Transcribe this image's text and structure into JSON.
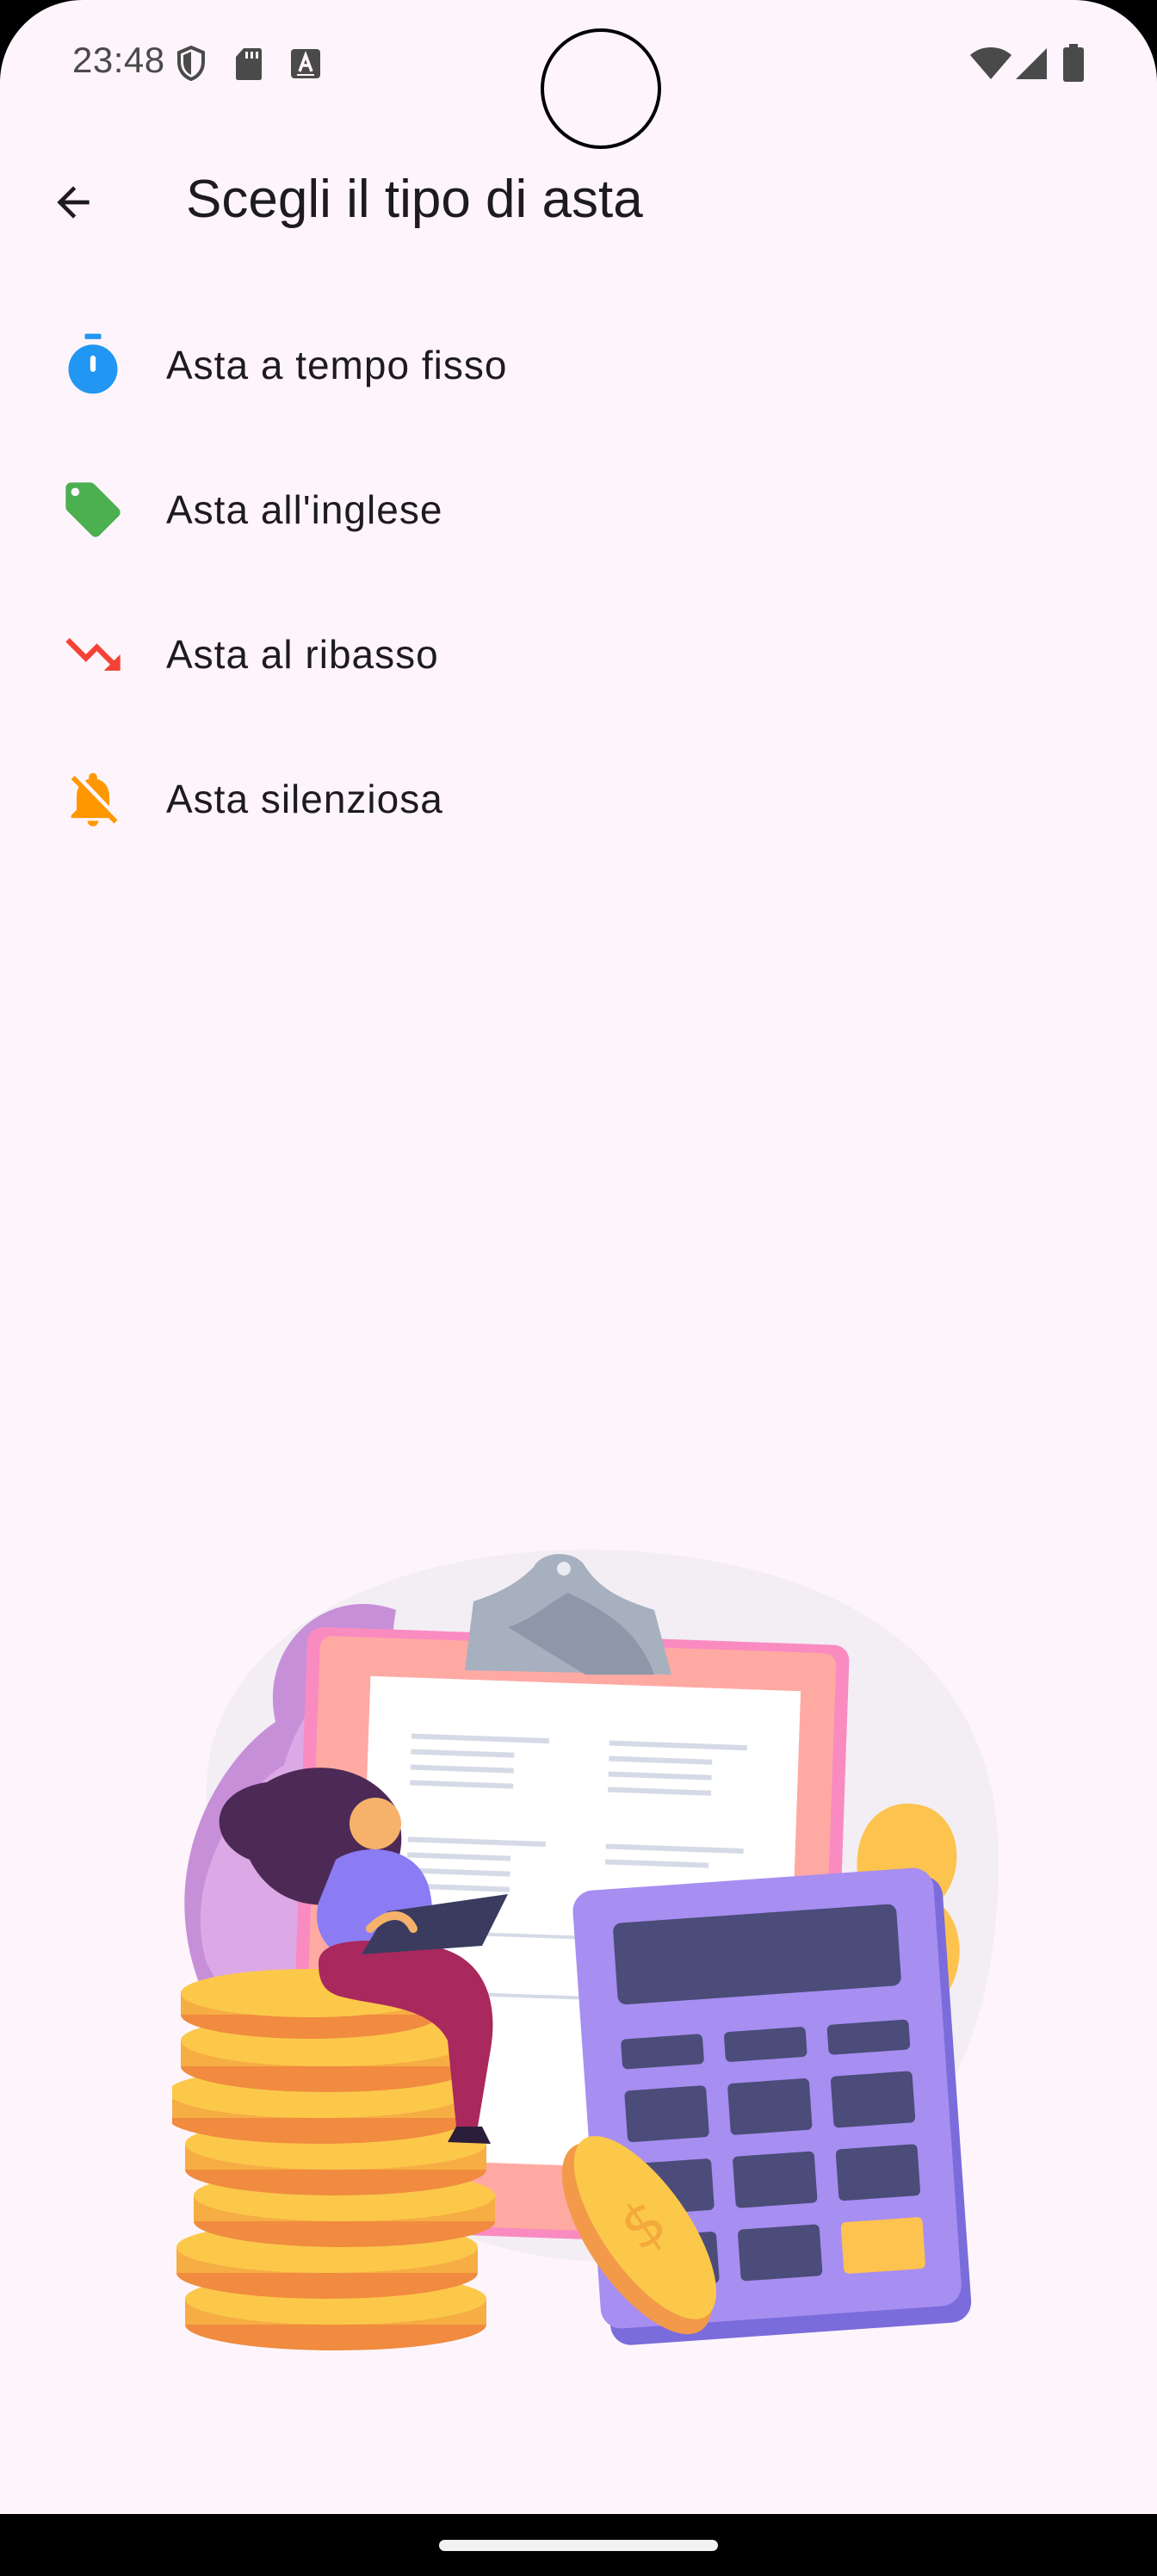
{
  "status_bar": {
    "time": "23:48",
    "left_icons": [
      "shield-icon",
      "sd-card-icon",
      "keyboard-a-icon"
    ],
    "right_icons": [
      "wifi-icon",
      "signal-icon",
      "battery-icon"
    ]
  },
  "app_bar": {
    "back_icon": "arrow-back-icon",
    "title": "Scegli il tipo di asta"
  },
  "auction_types": [
    {
      "label": "Asta a tempo fisso",
      "icon": "stopwatch-icon",
      "color": "#2196f3"
    },
    {
      "label": "Asta all'inglese",
      "icon": "tag-icon",
      "color": "#4caf50"
    },
    {
      "label": "Asta al ribasso",
      "icon": "trending-down-icon",
      "color": "#f44336"
    },
    {
      "label": "Asta silenziosa",
      "icon": "notifications-off-icon",
      "color": "#ff9800"
    }
  ],
  "colors": {
    "background": "#fdf5fb",
    "text": "#1d1b20"
  },
  "illustration": "finance-clipboard-calculator-coins-illustration"
}
